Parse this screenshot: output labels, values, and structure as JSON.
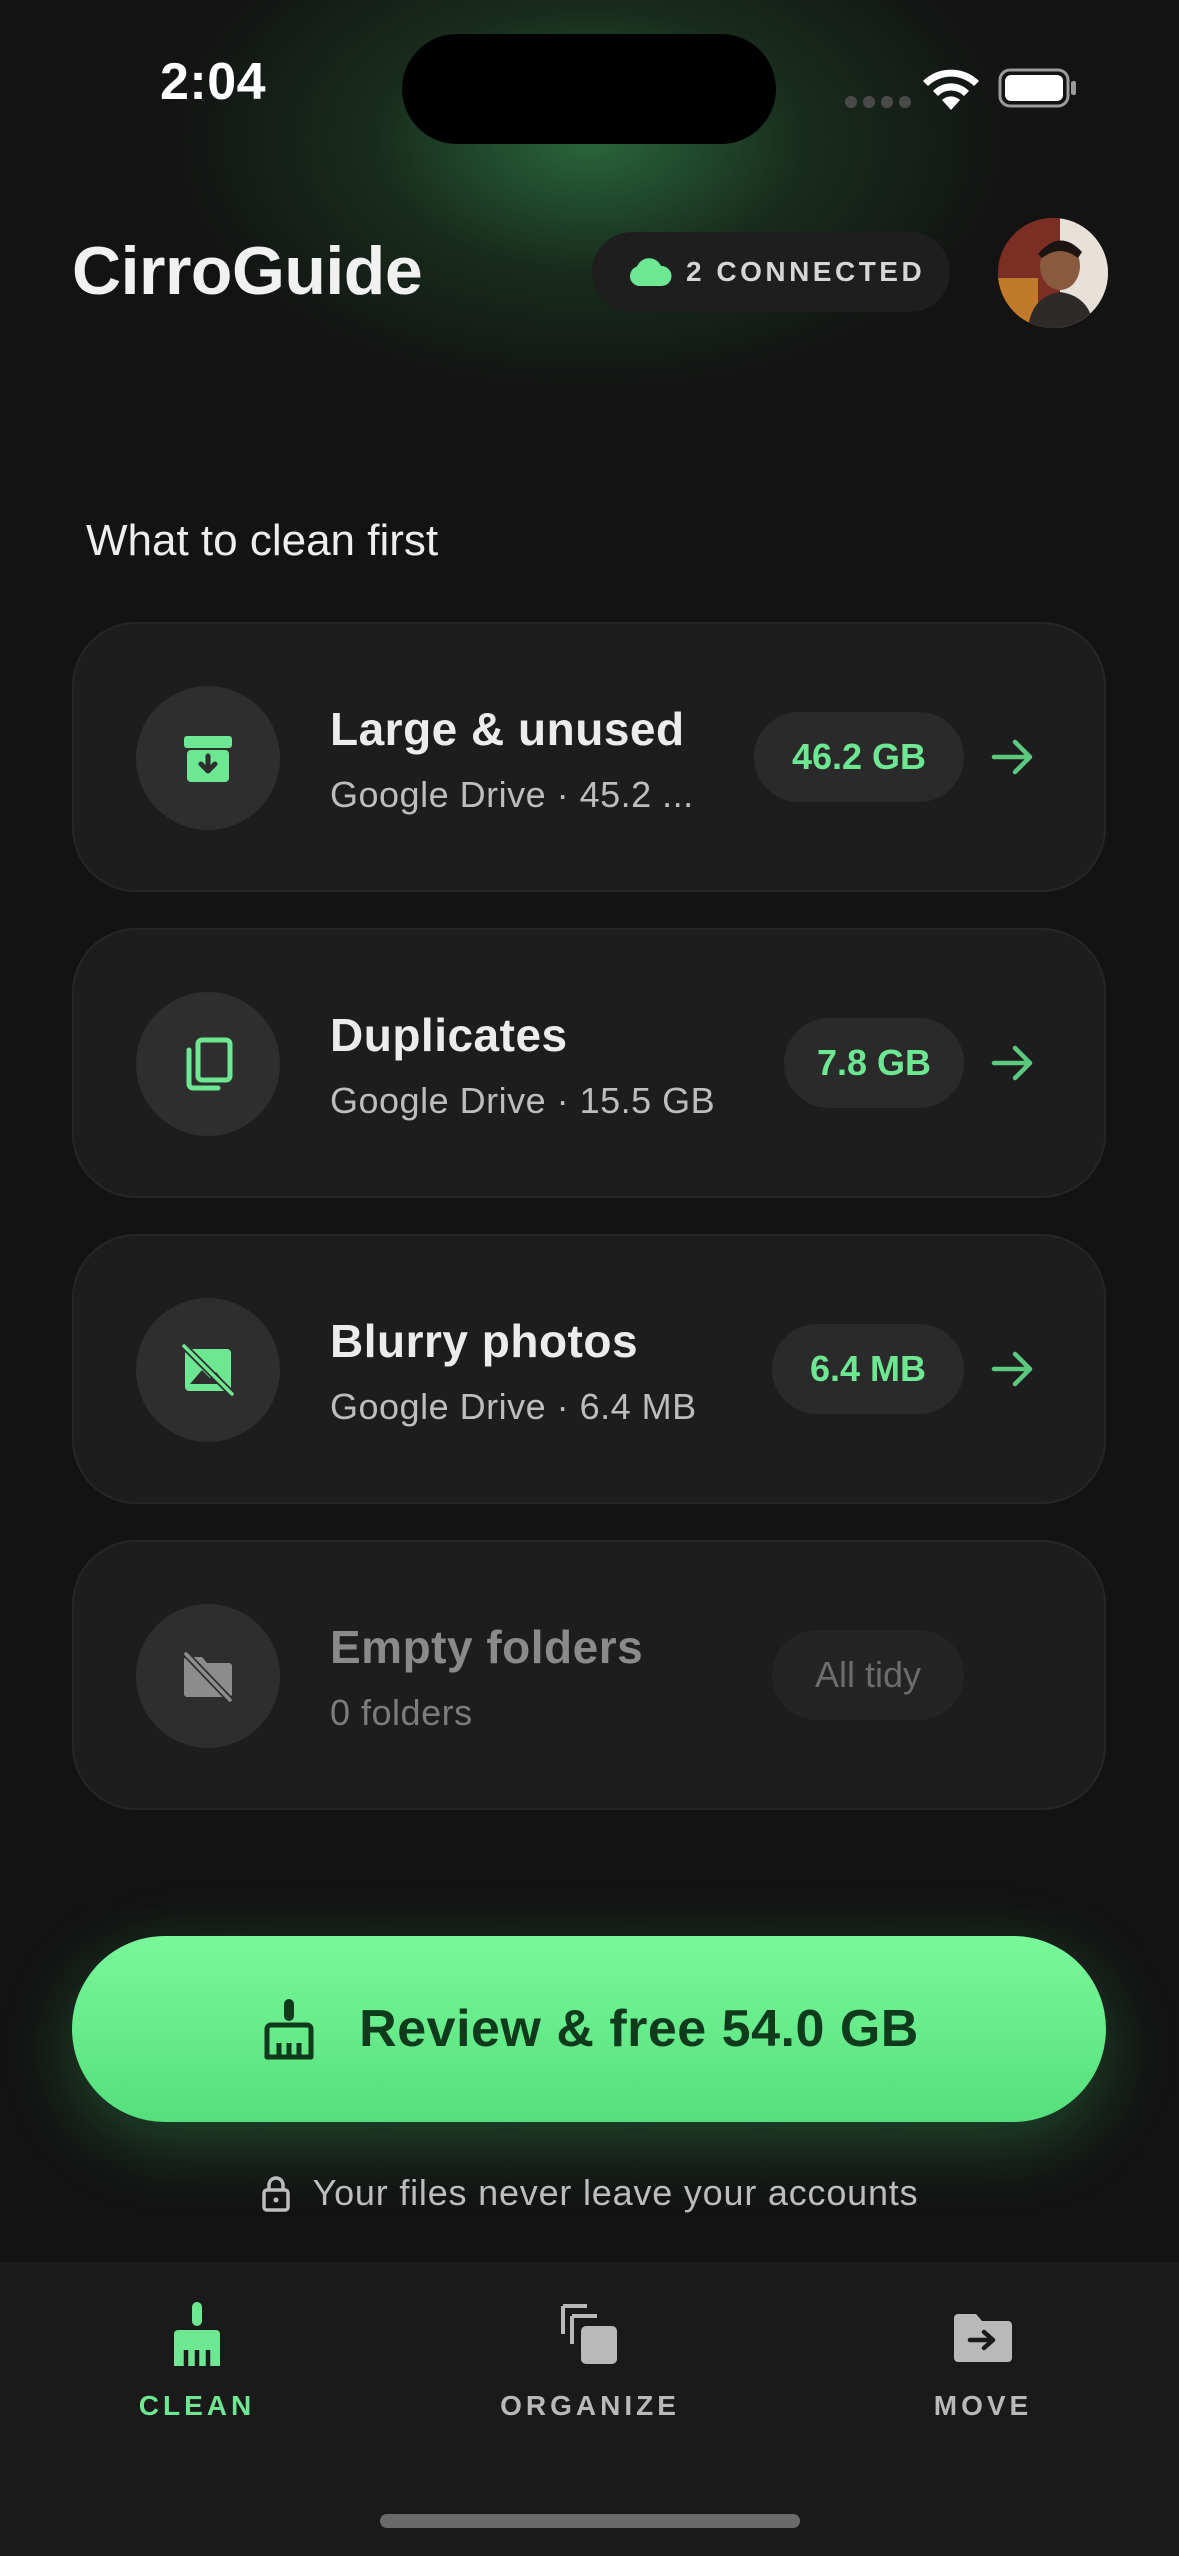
{
  "status_bar": {
    "time": "2:04"
  },
  "header": {
    "app_title": "CirroGuide",
    "connected_label": "2 CONNECTED"
  },
  "section_title": "What to clean first",
  "cards": [
    {
      "title": "Large & unused",
      "subtitle": "Google Drive · 45.2 ...",
      "size": "46.2 GB",
      "icon": "archive-download-icon",
      "enabled": true
    },
    {
      "title": "Duplicates",
      "subtitle": "Google Drive · 15.5 GB",
      "size": "7.8 GB",
      "icon": "copy-icon",
      "enabled": true
    },
    {
      "title": "Blurry photos",
      "subtitle": "Google Drive · 6.4 MB",
      "size": "6.4 MB",
      "icon": "image-off-icon",
      "enabled": true
    },
    {
      "title": "Empty folders",
      "subtitle": "0 folders",
      "size": "All tidy",
      "icon": "folder-off-icon",
      "enabled": false
    }
  ],
  "cta": {
    "label": "Review & free 54.0 GB",
    "icon": "broom-icon"
  },
  "privacy_note": "Your files never leave your accounts",
  "tabs": [
    {
      "label": "CLEAN",
      "icon": "broom-icon",
      "active": true
    },
    {
      "label": "ORGANIZE",
      "icon": "stack-icon",
      "active": false
    },
    {
      "label": "MOVE",
      "icon": "folder-move-icon",
      "active": false
    }
  ],
  "colors": {
    "background": "#131313",
    "card": "#1d1d1d",
    "accent": "#6ee792",
    "cta_top": "#79f89a",
    "cta_bottom": "#55df7c",
    "cta_text": "#0f3a1c"
  }
}
